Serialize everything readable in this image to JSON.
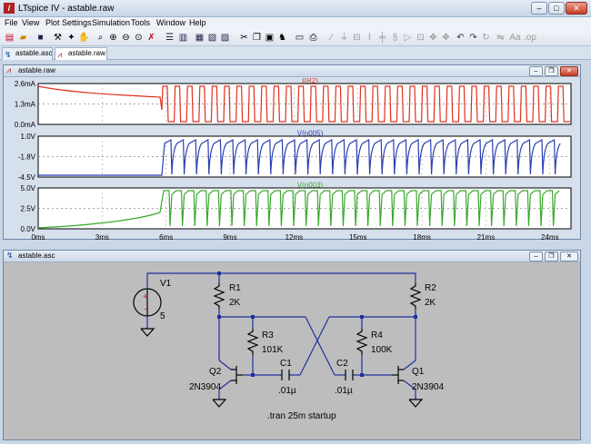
{
  "window": {
    "title": "LTspice IV - astable.raw",
    "app_icon": "ltspice-logo",
    "buttons": [
      "minimize",
      "maximize",
      "close"
    ]
  },
  "menu": [
    "File",
    "View",
    "Plot Settings",
    "Simulation",
    "Tools",
    "Window",
    "Help"
  ],
  "toolbar_icons": [
    "new-schematic-icon",
    "open-icon",
    "save-icon",
    "control-panel-icon",
    "run-icon",
    "halt-icon",
    "zoom-area-icon",
    "zoom-in-icon",
    "zoom-out-icon",
    "zoom-fit-icon",
    "autorange-icon",
    "tile-horizontal-icon",
    "tile-vertical-icon",
    "cascade-icon",
    "close-all-icon",
    "cut-icon",
    "copy-icon",
    "paste-icon",
    "find-icon",
    "print-icon",
    "print-preview-icon",
    "wire-icon",
    "ground-icon",
    "label-icon",
    "resistor-icon",
    "capacitor-icon",
    "inductor-icon",
    "diode-icon",
    "component-icon",
    "move-icon",
    "drag-icon",
    "undo-icon",
    "redo-icon",
    "text-icon",
    "spice-directive-icon"
  ],
  "tabs": [
    {
      "label": "astable.asc",
      "icon": "schematic-icon",
      "active": false
    },
    {
      "label": "astable.raw",
      "icon": "waveform-icon",
      "active": true
    }
  ],
  "waveform_window": {
    "title": "astable.raw",
    "x_ticks": [
      "0ms",
      "3ms",
      "6ms",
      "9ms",
      "12ms",
      "15ms",
      "18ms",
      "21ms",
      "24ms"
    ],
    "panes": [
      {
        "trace": "I(R2)",
        "color": "#e0301e",
        "y_ticks": [
          "2.6mA",
          "1.3mA",
          "0.0mA"
        ]
      },
      {
        "trace": "V(n005)",
        "color": "#2a3fb0",
        "y_ticks": [
          "1.0V",
          "-1.8V",
          "-4.5V"
        ]
      },
      {
        "trace": "V(n003)",
        "color": "#3aa82e",
        "y_ticks": [
          "5.0V",
          "2.5V",
          "0.0V"
        ]
      }
    ]
  },
  "schematic_window": {
    "title": "astable.asc",
    "components": {
      "v1": {
        "name": "V1",
        "value": "5"
      },
      "r1": {
        "name": "R1",
        "value": "2K"
      },
      "r2": {
        "name": "R2",
        "value": "2K"
      },
      "r3": {
        "name": "R3",
        "value": "101K"
      },
      "r4": {
        "name": "R4",
        "value": "100K"
      },
      "c1": {
        "name": "C1",
        "value": ".01µ"
      },
      "c2": {
        "name": "C2",
        "value": ".01µ"
      },
      "q1": {
        "name": "Q1",
        "model": "2N3904"
      },
      "q2": {
        "name": "Q2",
        "model": "2N3904"
      }
    },
    "directive": ".tran 25m startup"
  }
}
